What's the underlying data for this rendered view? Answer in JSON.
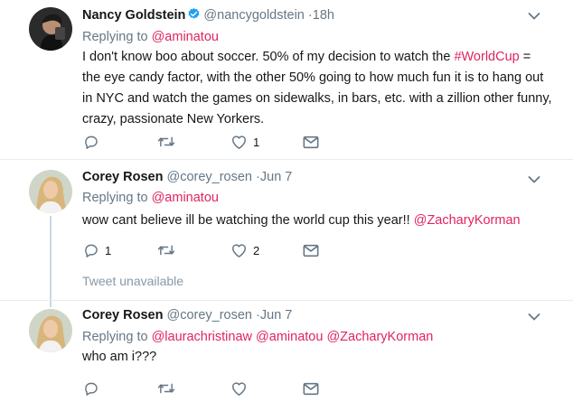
{
  "tweets": [
    {
      "name": "Nancy Goldstein",
      "handle": "@nancygoldstein",
      "time": "18h",
      "replying_prefix": "Replying to ",
      "replying_to": [
        "@aminatou"
      ],
      "text_lines": [
        "I don't know boo about soccer. 50% of my decision to watch the #WorldCup =",
        "the eye candy factor, with the other 50% going to how much fun it is to hang out",
        "in NYC and watch the games on sidewalks, in bars, etc. with a zillion other funny,",
        "crazy, passionate New Yorkers."
      ],
      "hashtag": "#WorldCup",
      "reply_count": "",
      "retweet_count": "",
      "like_count": "1",
      "verified": true
    },
    {
      "name": "Corey Rosen",
      "handle": "@corey_rosen",
      "time": "Jun 7",
      "replying_prefix": "Replying to ",
      "replying_to": [
        "@aminatou"
      ],
      "text_prefix": "wow cant believe ill be watching the world cup this year!! ",
      "mention": "@ZacharyKorman",
      "reply_count": "1",
      "retweet_count": "",
      "like_count": "2"
    },
    {
      "name": "Corey Rosen",
      "handle": "@corey_rosen",
      "time": "Jun 7",
      "replying_prefix": "Replying to ",
      "replying_to": [
        "@laurachristinaw",
        "@aminatou",
        "@ZacharyKorman"
      ],
      "text": "who am i???",
      "reply_count": "",
      "retweet_count": "",
      "like_count": ""
    }
  ],
  "unavailable_text": "Tweet unavailable",
  "separator": "·",
  "colors": {
    "link": "#e0245e",
    "muted": "#657786",
    "verified": "#1da1f2",
    "icon": "#657786"
  }
}
